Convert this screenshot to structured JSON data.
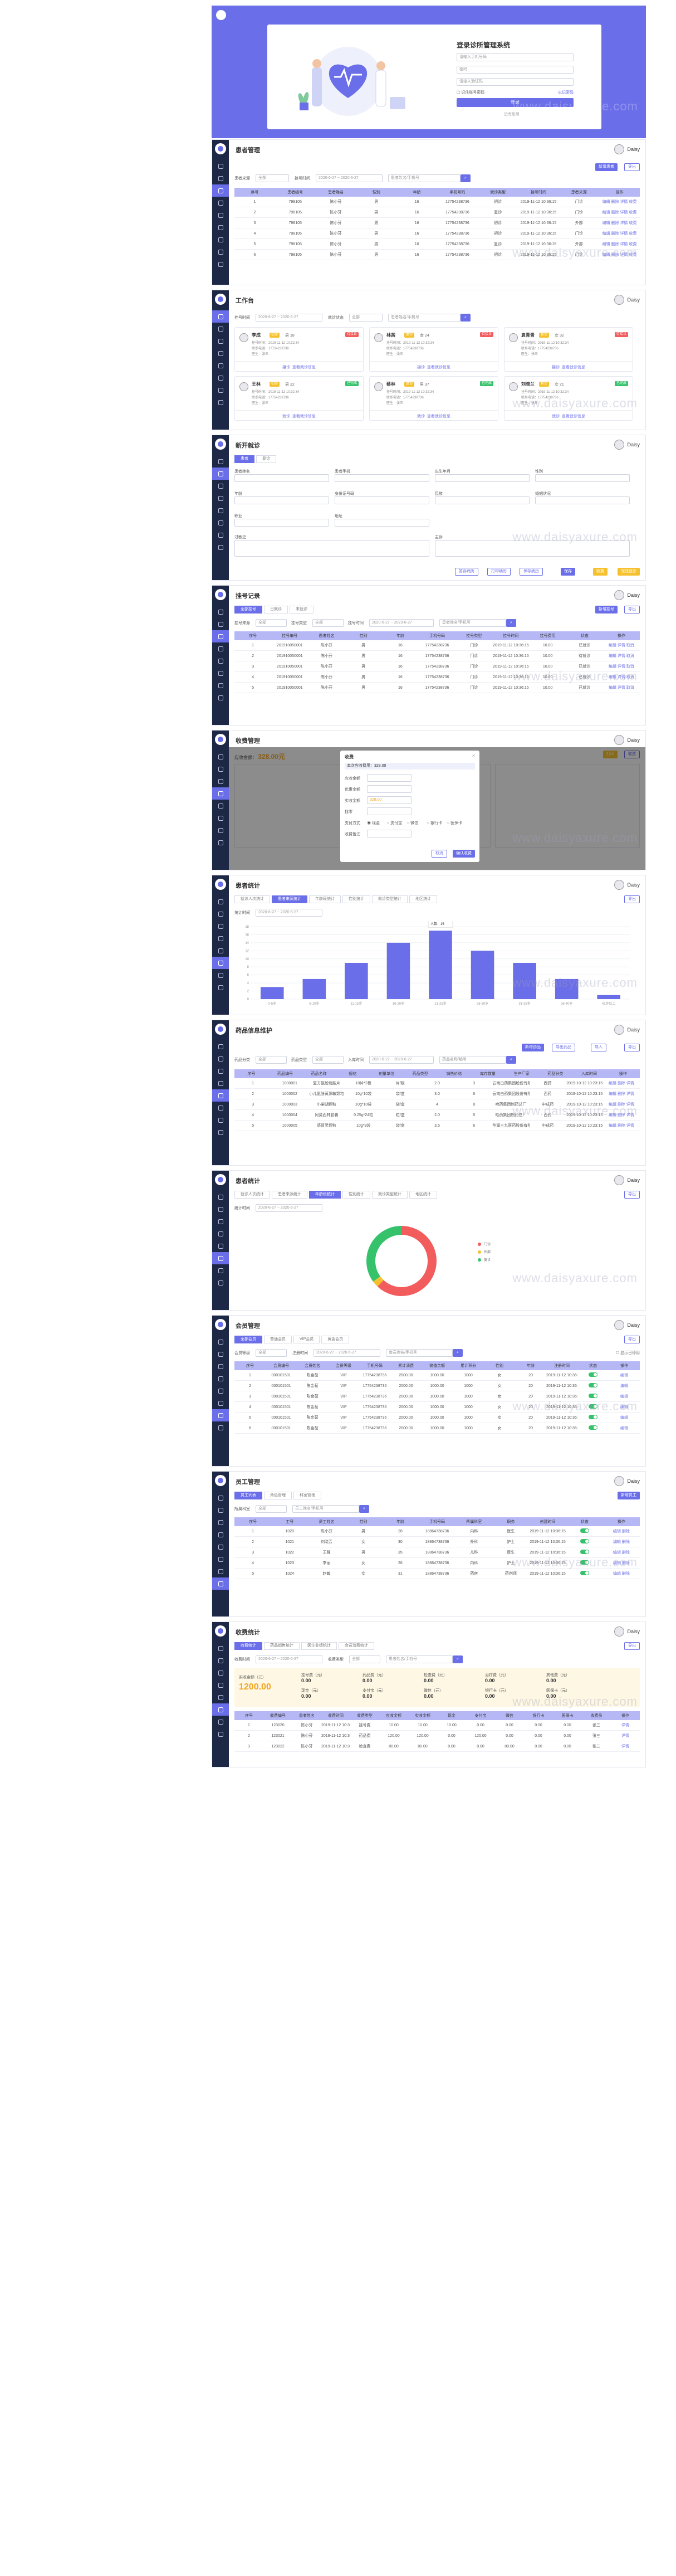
{
  "common": {
    "user": "Daisy",
    "watermark": "www.daisyaxure.com"
  },
  "login": {
    "title": "登录诊所管理系统",
    "phone_placeholder": "请输入手机号码",
    "password_placeholder": "密码",
    "code_placeholder": "请输入验证码",
    "remember": "记住账号密码",
    "forgot": "忘记密码",
    "submit": "登录",
    "register": "没有账号"
  },
  "patients": {
    "title": "患者管理",
    "filter": {
      "label1": "患者来源",
      "value1": "全部",
      "label2": "挂号时间",
      "date": "2020-6-27 ~ 2020-6-27",
      "search": "患者姓名/手机号"
    },
    "buttons": {
      "add": "新增患者",
      "export": "导出"
    },
    "headers": [
      "序号",
      "患者编号",
      "患者姓名",
      "性别",
      "年龄",
      "手机号码",
      "就诊类型",
      "挂号时间",
      "患者来源",
      "操作"
    ],
    "rows": [
      [
        "1",
        "798105",
        "陈小芬",
        "男",
        "16",
        "17754238736",
        "初诊",
        "2019-11-12 10:36:15",
        "门诊",
        "编辑 删除 详情 收费"
      ],
      [
        "2",
        "798105",
        "陈小芬",
        "男",
        "16",
        "17754238736",
        "复诊",
        "2019-11-12 10:36:15",
        "门诊",
        "编辑 删除 详情 收费"
      ],
      [
        "3",
        "798105",
        "陈小芬",
        "男",
        "16",
        "17754238736",
        "初诊",
        "2019-11-12 10:36:15",
        "外部",
        "编辑 删除 详情 收费"
      ],
      [
        "4",
        "798105",
        "陈小芬",
        "男",
        "16",
        "17754238736",
        "初诊",
        "2019-11-12 10:36:15",
        "门诊",
        "编辑 删除 详情 收费"
      ],
      [
        "5",
        "798105",
        "陈小芬",
        "男",
        "16",
        "17754238736",
        "复诊",
        "2019-11-12 10:36:15",
        "外部",
        "编辑 删除 详情 收费"
      ],
      [
        "6",
        "798105",
        "陈小芬",
        "男",
        "16",
        "17754238736",
        "初诊",
        "2019-11-12 10:36:15",
        "门诊",
        "编辑 删除 详情 收费"
      ]
    ]
  },
  "workbench": {
    "title": "工作台",
    "filter": {
      "label1": "挂号时间",
      "date": "2020-6-27 ~ 2020-6-27",
      "label2": "就诊状态",
      "value2": "全部",
      "search": "患者姓名/手机号"
    },
    "cards": [
      {
        "name": "李成",
        "type": "初诊",
        "age": "男 18",
        "status": "待接诊",
        "status_color": "#f25c5c",
        "line1": "挂号时间：2019-11-12 10:32:34",
        "line2": "联系电话：17754238736",
        "doctor": "医生：张三",
        "actions": "接诊  查看就诊信息"
      },
      {
        "name": "林茜",
        "type": "复诊",
        "age": "女 24",
        "status": "待接诊",
        "status_color": "#f25c5c",
        "line1": "挂号时间：2019-11-12 10:32:34",
        "line2": "联系电话：17754238736",
        "doctor": "医生：张三",
        "actions": "接诊  查看就诊信息"
      },
      {
        "name": "袁青青",
        "type": "初诊",
        "age": "女 32",
        "status": "待接诊",
        "status_color": "#f25c5c",
        "line1": "挂号时间：2019-11-12 10:32:34",
        "line2": "联系电话：17754238736",
        "doctor": "医生：张三",
        "actions": "接诊  查看就诊信息"
      },
      {
        "name": "王林",
        "type": "初诊",
        "age": "男 22",
        "status": "已完成",
        "status_color": "#35c26a",
        "line1": "挂号时间：2019-11-12 10:32:34",
        "line2": "联系电话：17754238736",
        "doctor": "医生：张三",
        "actions": "就诊  查看就诊信息"
      },
      {
        "name": "蔡林",
        "type": "复诊",
        "age": "男 37",
        "status": "已完成",
        "status_color": "#35c26a",
        "line1": "挂号时间：2019-11-12 10:32:34",
        "line2": "联系电话：17754238736",
        "doctor": "医生：张三",
        "actions": "就诊  查看就诊信息"
      },
      {
        "name": "刘晓兰",
        "type": "初诊",
        "age": "女 21",
        "status": "已完成",
        "status_color": "#35c26a",
        "line1": "挂号时间：2019-11-12 10:32:34",
        "line2": "联系电话：17754238736",
        "doctor": "医生：张三",
        "actions": "就诊  查看就诊信息"
      }
    ]
  },
  "visit": {
    "title": "新开就诊",
    "tabs": [
      "患者",
      "复诊"
    ],
    "fields": [
      "患者姓名",
      "患者手机",
      "出生年月",
      "性别",
      "年龄",
      "身份证号码",
      "民族",
      "婚姻状况",
      "职业",
      "地址",
      "过敏史",
      "主诉"
    ],
    "buttons": [
      "暂存病历",
      "打印病历",
      "保存病历",
      "保存",
      "收费",
      "完成就诊"
    ]
  },
  "registration": {
    "title": "挂号记录",
    "tabs": [
      "全部挂号",
      "已就诊",
      "未就诊"
    ],
    "filter": {
      "label1": "挂号来源",
      "value1": "全部",
      "label2": "挂号类型",
      "value2": "全部",
      "label3": "挂号时间",
      "date": "2020-6-27 ~ 2020-6-27",
      "search": "患者姓名/手机号"
    },
    "buttons": {
      "add": "新增挂号",
      "export": "导出"
    },
    "headers": [
      "序号",
      "挂号编号",
      "患者姓名",
      "性别",
      "年龄",
      "手机号码",
      "挂号类型",
      "挂号时间",
      "挂号费用",
      "状态",
      "操作"
    ],
    "rows": [
      [
        "1",
        "201910050001",
        "陈小芬",
        "男",
        "16",
        "17754238736",
        "门诊",
        "2019-11-12 10:36:15",
        "10.00",
        "已就诊",
        "编辑 详情 取消"
      ],
      [
        "2",
        "201910050001",
        "陈小芬",
        "男",
        "16",
        "17754238736",
        "门诊",
        "2019-11-12 10:36:15",
        "10.00",
        "待就诊",
        "编辑 详情 取消"
      ],
      [
        "3",
        "201910050001",
        "陈小芬",
        "男",
        "16",
        "17754238736",
        "门诊",
        "2019-11-12 10:36:15",
        "10.00",
        "已就诊",
        "编辑 详情 取消"
      ],
      [
        "4",
        "201910050001",
        "陈小芬",
        "男",
        "16",
        "17754238736",
        "门诊",
        "2019-11-12 10:36:15",
        "10.00",
        "已就诊",
        "编辑 详情 取消"
      ],
      [
        "5",
        "201910050001",
        "陈小芬",
        "男",
        "16",
        "17754238736",
        "门诊",
        "2019-11-12 10:36:15",
        "10.00",
        "已就诊",
        "编辑 详情 取消"
      ]
    ]
  },
  "charge": {
    "title": "收费管理",
    "total_label": "应收金额：",
    "total": "328.00元",
    "dialog": {
      "title": "收费",
      "subtitle": "本次应收费用：328.00",
      "fields": [
        "应收金额",
        "优惠金额",
        "实收金额",
        "找零",
        "支付方式",
        "收费备注"
      ],
      "amount": "328.00",
      "pay_methods": [
        "现金",
        "支付宝",
        "微信",
        "银行卡",
        "医保卡"
      ],
      "cancel": "取消",
      "confirm": "确认收费"
    },
    "buttons": {
      "print": "打印",
      "charge": "收费"
    }
  },
  "patient_stats": {
    "title": "患者统计",
    "tabs": [
      "就诊人次统计",
      "患者来源统计",
      "年龄段统计",
      "性别统计",
      "就诊类型统计",
      "地区统计"
    ],
    "export": "导出",
    "label": "统计时间",
    "date": "2020-6-27 ~ 2020-6-27",
    "tooltip": {
      "title": "16岁",
      "value": "人数：15"
    }
  },
  "chart_data": {
    "type": "bar",
    "categories": [
      "0-5岁",
      "6-10岁",
      "11-15岁",
      "16-20岁",
      "21-25岁",
      "26-30岁",
      "31-35岁",
      "36-40岁",
      "41岁以上"
    ],
    "values": [
      3,
      5,
      9,
      14,
      17,
      12,
      9,
      5,
      1
    ],
    "ylim": [
      0,
      18
    ],
    "yticks": [
      0,
      2,
      4,
      6,
      8,
      10,
      12,
      14,
      16,
      18
    ],
    "bar_color": "#6a6ee8"
  },
  "drugs": {
    "title": "药品信息维护",
    "filter": {
      "label1": "药品分类",
      "value1": "全部",
      "label2": "药品类型",
      "value2": "全部",
      "label3": "入库时间",
      "date": "2020-6-27 ~ 2020-6-27",
      "search": "药品名称/编号"
    },
    "buttons": [
      "新增药品",
      "导出药品",
      "导入",
      "导出"
    ],
    "headers": [
      "序号",
      "药品编号",
      "药品名称",
      "规格",
      "剂量单位",
      "药品类型",
      "销售价格",
      "库存数量",
      "生产厂家",
      "药品分类",
      "入库时间",
      "操作"
    ],
    "rows": [
      [
        "1",
        "1000001",
        "复方氨酚烷胺片",
        "10片*2板",
        "片/板",
        "2.0",
        "3",
        "云南白药集团股份有限公司",
        "西药",
        "2019-10-12 10:23:15",
        "编辑 删除 详情"
      ],
      [
        "2",
        "1000002",
        "小儿氨酚黄那敏颗粒",
        "10g*10袋",
        "袋/盒",
        "3.0",
        "6",
        "云南白药集团股份有限公司",
        "西药",
        "2019-10-12 10:23:15",
        "编辑 删除 详情"
      ],
      [
        "3",
        "1000003",
        "小柴胡颗粒",
        "10g*10袋",
        "袋/盒",
        "4",
        "8",
        "哈药集团制药总厂",
        "中成药",
        "2019-10-12 10:23:15",
        "编辑 删除 详情"
      ],
      [
        "4",
        "1000004",
        "阿莫西林胶囊",
        "0.25g*24粒",
        "粒/盒",
        "2.0",
        "5",
        "哈药集团制药总厂",
        "西药",
        "2019-10-12 10:23:15",
        "编辑 删除 详情"
      ],
      [
        "5",
        "1000005",
        "感冒灵颗粒",
        "10g*9袋",
        "袋/盒",
        "3.5",
        "6",
        "华润三九医药股份有限公司",
        "中成药",
        "2019-10-12 10:23:15",
        "编辑 删除 详情"
      ]
    ]
  },
  "patient_stats2": {
    "title": "患者统计",
    "tabs": [
      "就诊人次统计",
      "患者来源统计",
      "年龄段统计",
      "性别统计",
      "就诊类型统计",
      "地区统计"
    ],
    "export": "导出",
    "label": "统计时间",
    "date": "2020-6-27 ~ 2020-6-27",
    "donut": [
      {
        "name": "门诊",
        "value": 62,
        "color": "#f25c5c"
      },
      {
        "name": "外部",
        "value": 3,
        "color": "#f5c12e"
      },
      {
        "name": "复诊",
        "value": 35,
        "color": "#35c26a"
      }
    ]
  },
  "members": {
    "title": "会员管理",
    "tabs": [
      "全部会员",
      "普通会员",
      "VIP会员",
      "黄金会员"
    ],
    "filter": {
      "label1": "会员等级",
      "value1": "全部",
      "label2": "注册时间",
      "date": "2020-6-27 ~ 2020-6-27",
      "search": "会员姓名/手机号",
      "check": "显示已停用"
    },
    "export": "导出",
    "headers": [
      "序号",
      "会员编号",
      "会员姓名",
      "会员等级",
      "手机号码",
      "累计消费",
      "储值余额",
      "累计积分",
      "性别",
      "年龄",
      "注册时间",
      "状态",
      "操作"
    ],
    "rows": [
      [
        "1",
        "000101501",
        "陈金茹",
        "VIP",
        "17754238736",
        "2000.00",
        "1000.00",
        "1000",
        "女",
        "20",
        "2019-11-12 10:36:15",
        "",
        "编辑"
      ],
      [
        "2",
        "000101501",
        "陈金茹",
        "VIP",
        "17754238736",
        "2000.00",
        "1000.00",
        "1000",
        "女",
        "20",
        "2019-11-12 10:36:15",
        "",
        "编辑"
      ],
      [
        "3",
        "000101501",
        "陈金茹",
        "VIP",
        "17754238736",
        "2000.00",
        "1000.00",
        "1000",
        "女",
        "20",
        "2019-11-12 10:36:15",
        "",
        "编辑"
      ],
      [
        "4",
        "000101501",
        "陈金茹",
        "VIP",
        "17754238736",
        "2000.00",
        "1000.00",
        "1000",
        "女",
        "20",
        "2019-11-12 10:36:15",
        "",
        "编辑"
      ],
      [
        "5",
        "000101501",
        "陈金茹",
        "VIP",
        "17754238736",
        "2000.00",
        "1000.00",
        "1000",
        "女",
        "20",
        "2019-11-12 10:36:15",
        "",
        "编辑"
      ],
      [
        "6",
        "000101501",
        "陈金茹",
        "VIP",
        "17754238736",
        "2000.00",
        "1000.00",
        "1000",
        "女",
        "20",
        "2019-11-12 10:36:15",
        "",
        "编辑"
      ]
    ]
  },
  "staff": {
    "title": "员工管理",
    "tabs": [
      "员工列表",
      "角色管理",
      "科室管理"
    ],
    "filter": {
      "label1": "所属科室",
      "value1": "全部",
      "search": "员工姓名/手机号"
    },
    "add": "新增员工",
    "headers": [
      "序号",
      "工号",
      "员工姓名",
      "性别",
      "年龄",
      "手机号码",
      "所属科室",
      "职务",
      "创建时间",
      "状态",
      "操作"
    ],
    "rows": [
      [
        "1",
        "1020",
        "陈小芬",
        "男",
        "28",
        "18864738736",
        "内科",
        "医生",
        "2019-11-12 10:36:15",
        "",
        "编辑 删除"
      ],
      [
        "2",
        "1021",
        "刘晓芳",
        "女",
        "30",
        "18864738736",
        "外科",
        "护士",
        "2019-11-12 10:36:15",
        "",
        "编辑 删除"
      ],
      [
        "3",
        "1022",
        "王强",
        "男",
        "35",
        "18864738736",
        "儿科",
        "医生",
        "2019-11-12 10:36:15",
        "",
        "编辑 删除"
      ],
      [
        "4",
        "1023",
        "李丽",
        "女",
        "26",
        "18864738736",
        "内科",
        "护士",
        "2019-11-12 10:36:15",
        "",
        "编辑 删除"
      ],
      [
        "5",
        "1024",
        "赵敏",
        "女",
        "31",
        "18864738736",
        "药房",
        "药剂师",
        "2019-11-12 10:36:15",
        "",
        "编辑 删除"
      ]
    ]
  },
  "revenue": {
    "title": "收费统计",
    "tabs": [
      "收费统计",
      "药品销售统计",
      "医生业绩统计",
      "会员消费统计"
    ],
    "filter": {
      "label1": "收费时间",
      "date": "2020-6-27 ~ 2020-6-27",
      "label2": "收费类型",
      "value2": "全部",
      "search": "患者姓名/手机号"
    },
    "export": "导出",
    "total_label": "实收金额（元）",
    "total": "1200.00",
    "summary": [
      [
        "挂号费（元）",
        "0.00"
      ],
      [
        "药品费（元）",
        "0.00"
      ],
      [
        "检查费（元）",
        "0.00"
      ],
      [
        "治疗费（元）",
        "0.00"
      ],
      [
        "其他费（元）",
        "0.00"
      ],
      [
        "现金（元）",
        "0.00"
      ],
      [
        "支付宝（元）",
        "0.00"
      ],
      [
        "微信（元）",
        "0.00"
      ],
      [
        "银行卡（元）",
        "0.00"
      ],
      [
        "医保卡（元）",
        "0.00"
      ]
    ],
    "headers": [
      "序号",
      "收费编号",
      "患者姓名",
      "收费时间",
      "收费类型",
      "应收金额",
      "实收金额",
      "现金",
      "支付宝",
      "微信",
      "银行卡",
      "医保卡",
      "收费员",
      "操作"
    ],
    "rows": [
      [
        "1",
        "123020",
        "陈小芬",
        "2019-11-12 10:36",
        "挂号费",
        "10.00",
        "10.00",
        "10.00",
        "0.00",
        "0.00",
        "0.00",
        "0.00",
        "张三",
        "详情"
      ],
      [
        "2",
        "123021",
        "陈小芬",
        "2019-11-12 10:36",
        "药品费",
        "120.00",
        "120.00",
        "0.00",
        "120.00",
        "0.00",
        "0.00",
        "0.00",
        "张三",
        "详情"
      ],
      [
        "3",
        "123022",
        "陈小芬",
        "2019-11-12 10:36",
        "检查费",
        "80.00",
        "80.00",
        "0.00",
        "0.00",
        "80.00",
        "0.00",
        "0.00",
        "张三",
        "详情"
      ]
    ]
  }
}
